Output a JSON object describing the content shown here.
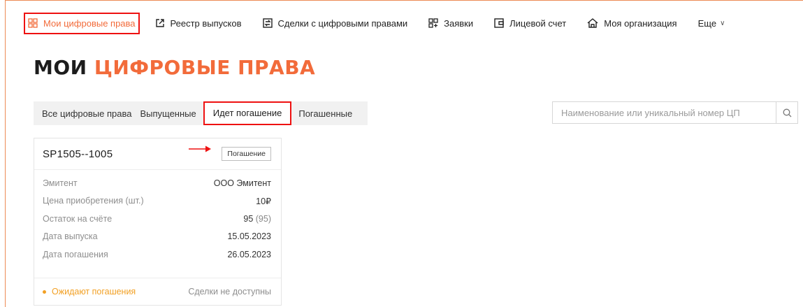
{
  "nav": {
    "items": [
      {
        "label": "Мои цифровые права",
        "icon": "grid-icon",
        "active": true
      },
      {
        "label": "Реестр выпусков",
        "icon": "external-link-icon"
      },
      {
        "label": "Сделки с цифровыми правами",
        "icon": "exchange-icon"
      },
      {
        "label": "Заявки",
        "icon": "apps-plus-icon"
      },
      {
        "label": "Лицевой счет",
        "icon": "wallet-icon"
      },
      {
        "label": "Моя организация",
        "icon": "home-icon"
      }
    ],
    "more_label": "Еще"
  },
  "page": {
    "title_part1": "МОИ",
    "title_part2": "ЦИФРОВЫЕ ПРАВА"
  },
  "tabs": [
    {
      "label": "Все цифровые права"
    },
    {
      "label": "Выпущенные"
    },
    {
      "label": "Идет погашение",
      "active": true
    },
    {
      "label": "Погашенные"
    }
  ],
  "search": {
    "placeholder": "Наименование или уникальный номер ЦП",
    "icon": "search-icon"
  },
  "card": {
    "id": "SP1505--1005",
    "badge": "Погашение",
    "rows": [
      {
        "label": "Эмитент",
        "value": "ООО Эмитент"
      },
      {
        "label": "Цена приобретения (шт.)",
        "value": "10₽"
      },
      {
        "label": "Остаток на счёте",
        "value": "95",
        "value_extra": "(95)"
      },
      {
        "label": "Дата выпуска",
        "value": "15.05.2023"
      },
      {
        "label": "Дата погашения",
        "value": "26.05.2023"
      }
    ],
    "status": "Ожидают погашения",
    "deals": "Сделки не доступны"
  },
  "colors": {
    "accent": "#f26b3a",
    "highlight_box": "#e11111",
    "status": "#f2a024"
  }
}
